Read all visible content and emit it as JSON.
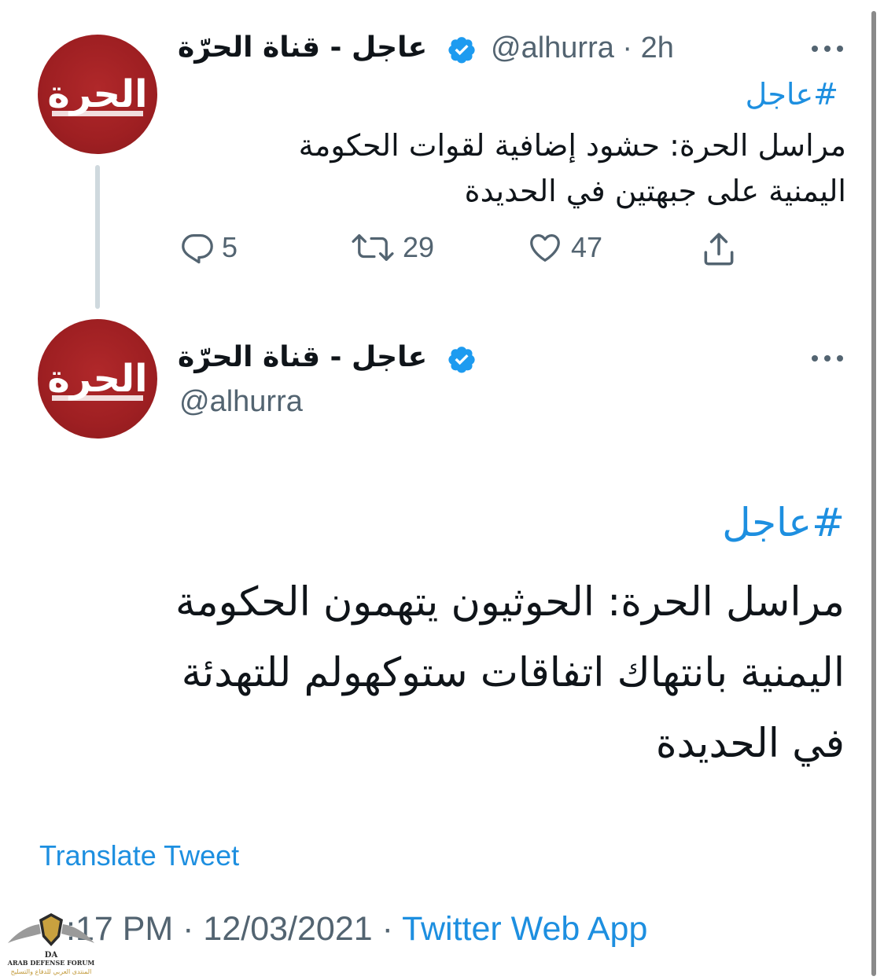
{
  "tweet_1": {
    "display_name": "عاجل - قناة الحرّة",
    "handle_time": "@alhurra · 2h",
    "avatar_logo_text": "الحرة",
    "hashtag": "#عاجل",
    "body_lines": [
      "مراسل الحرة: حشود إضافية لقوات الحكومة",
      "اليمنية على جبهتين في الحديدة"
    ],
    "actions": {
      "reply_count": "5",
      "retweet_count": "29",
      "like_count": "47"
    }
  },
  "tweet_2": {
    "display_name": "عاجل - قناة الحرّة",
    "handle": "@alhurra",
    "avatar_logo_text": "الحرة",
    "hashtag": "#عاجل",
    "body_lines": [
      "مراسل الحرة: الحوثيون يتهمون الحكومة",
      "اليمنية بانتهاك اتفاقات ستوكهولم للتهدئة",
      "في الحديدة"
    ],
    "translate_label": "Translate Tweet",
    "timestamp": ":17 PM · 12/03/2021 · ",
    "source_app": "Twitter Web App"
  },
  "watermark": {
    "monogram": "DA",
    "title": "ARAB DEFENSE FORUM",
    "subtitle": "المنتدى العربي للدفاع والتسليح"
  },
  "icons": {
    "verified": "verified-badge-icon",
    "more": "more-options-icon",
    "reply": "reply-icon",
    "retweet": "retweet-icon",
    "like": "like-heart-icon",
    "share": "share-icon"
  },
  "colors": {
    "accent_blue": "#1d8fe0",
    "text_primary": "#0f1419",
    "text_secondary": "#536471",
    "avatar_red": "#9e1f22",
    "thread_line": "#cfd9de"
  }
}
